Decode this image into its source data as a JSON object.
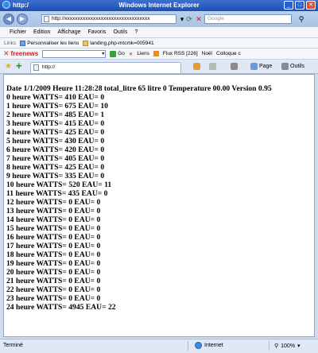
{
  "window": {
    "title_left": "http:/",
    "title": "Windows Internet Explorer",
    "min": "_",
    "max": "□",
    "close": "✕"
  },
  "address": {
    "url": "http://xxxxxxxxxxxxxxxxxxxxxxxxxxxxxxxxx",
    "search_placeholder": "Google"
  },
  "menu": [
    "Fichier",
    "Edition",
    "Affichage",
    "Favoris",
    "Outils",
    "?"
  ],
  "links": {
    "label": "Links",
    "items": [
      "Personnaliser les liens",
      "landing.php-mtcmk=005941"
    ]
  },
  "toolbar": {
    "brand": "freenews",
    "go": "Go",
    "liens": "Liens",
    "rss": "Flux RSS [226]",
    "noel": "Noël",
    "colloque": "Colloque c"
  },
  "tab": {
    "label": "http://"
  },
  "commands": {
    "page": "Page",
    "outils": "Outils"
  },
  "content": {
    "header": "Date 1/1/2009 Heure 11:28:28 total_litre 65 litre 0 Temperature 00.00 Version 0.95",
    "lines": [
      "0 heure WATTS= 410 EAU= 0",
      "1 heure WATTS= 675 EAU= 10",
      "2 heure WATTS= 485 EAU= 1",
      "3 heure WATTS= 415 EAU= 0",
      "4 heure WATTS= 425 EAU= 0",
      "5 heure WATTS= 430 EAU= 0",
      "6 heure WATTS= 420 EAU= 0",
      "7 heure WATTS= 405 EAU= 0",
      "8 heure WATTS= 425 EAU= 0",
      "9 heure WATTS= 335 EAU= 0",
      "10 heure WATTS= 520 EAU= 11",
      "11 heure WATTS= 435 EAU= 0",
      "12 heure WATTS= 0 EAU= 0",
      "13 heure WATTS= 0 EAU= 0",
      "14 heure WATTS= 0 EAU= 0",
      "15 heure WATTS= 0 EAU= 0",
      "16 heure WATTS= 0 EAU= 0",
      "17 heure WATTS= 0 EAU= 0",
      "18 heure WATTS= 0 EAU= 0",
      "19 heure WATTS= 0 EAU= 0",
      "20 heure WATTS= 0 EAU= 0",
      "21 heure WATTS= 0 EAU= 0",
      "22 heure WATTS= 0 EAU= 0",
      "23 heure WATTS= 0 EAU= 0",
      "24 heure WATTS= 4945 EAU= 22"
    ]
  },
  "status": {
    "left": "Terminé",
    "zone": "Internet",
    "zoom": "100%"
  }
}
